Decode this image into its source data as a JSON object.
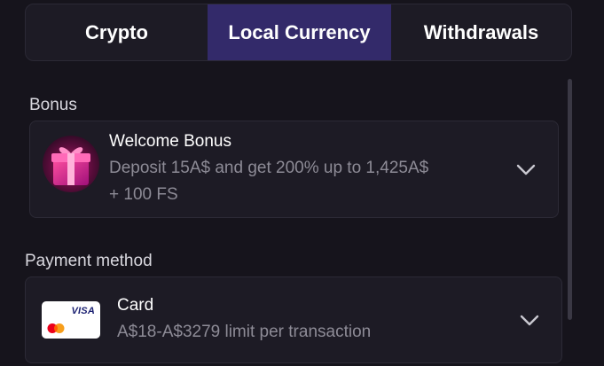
{
  "tabs": [
    {
      "label": "Crypto",
      "active": false
    },
    {
      "label": "Local Currency",
      "active": true
    },
    {
      "label": "Withdrawals",
      "active": false
    }
  ],
  "bonus": {
    "section_label": "Bonus",
    "title": "Welcome Bonus",
    "description_line1": "Deposit 15A$ and get 200% up to 1,425A$",
    "description_line2": "+ 100 FS",
    "icon": "gift-icon"
  },
  "payment": {
    "section_label": "Payment method",
    "title": "Card",
    "description": "A$18-A$3279 limit per transaction",
    "icon": "visa-mastercard-card-icon",
    "card_brand_text": "VISA"
  },
  "colors": {
    "background": "#16141c",
    "panel": "#1d1b25",
    "active_tab": "#332a6a",
    "muted_text": "#8d8b96"
  }
}
